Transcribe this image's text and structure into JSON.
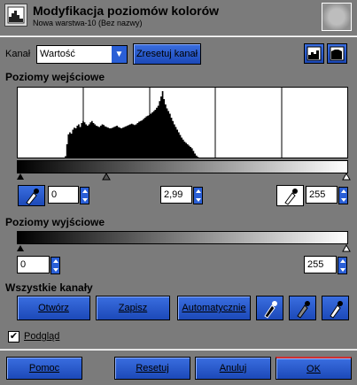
{
  "title": {
    "main": "Modyfikacja poziomów kolorów",
    "subtitle": "Nowa warstwa-10 (Bez nazwy)"
  },
  "channel": {
    "label": "Kanał",
    "selected": "Wartość",
    "reset_label": "Zresetuj kanał"
  },
  "input_levels": {
    "label": "Poziomy wejściowe",
    "low": "0",
    "gamma": "2,99",
    "high": "255"
  },
  "output_levels": {
    "label": "Poziomy wyjściowe",
    "low": "0",
    "high": "255"
  },
  "all_channels": {
    "label": "Wszystkie kanały",
    "open": "Otwórz",
    "save": "Zapisz",
    "auto": "Automatycznie"
  },
  "preview": {
    "label": "Podgląd",
    "checked": true
  },
  "footer": {
    "help": "Pomoc",
    "reset": "Resetuj",
    "cancel": "Anuluj",
    "ok": "OK"
  },
  "icons": {
    "dialog": "levels-dialog-icon",
    "picker": "eyedropper-icon",
    "linear": "linear-histogram-icon",
    "log": "logarithmic-histogram-icon"
  },
  "colors": {
    "background": "#7b7b7b",
    "button": "#2a5fd6",
    "ok_border": "#d03030"
  },
  "histogram": [
    0,
    0,
    0,
    0,
    0,
    0,
    0,
    0,
    0,
    0,
    0,
    0,
    0,
    0,
    0,
    0,
    0,
    0,
    0,
    0,
    0,
    0,
    0,
    0,
    0,
    0,
    0,
    0,
    0,
    0,
    0,
    0,
    0.02,
    0.2,
    0.35,
    0.38,
    0.36,
    0.42,
    0.45,
    0.44,
    0.48,
    0.5,
    0.46,
    0.52,
    0.55,
    0.53,
    0.5,
    0.48,
    0.5,
    0.53,
    0.55,
    0.52,
    0.5,
    0.48,
    0.47,
    0.46,
    0.48,
    0.5,
    0.49,
    0.47,
    0.46,
    0.45,
    0.44,
    0.44,
    0.45,
    0.46,
    0.47,
    0.48,
    0.46,
    0.45,
    0.44,
    0.45,
    0.46,
    0.47,
    0.48,
    0.49,
    0.5,
    0.51,
    0.5,
    0.49,
    0.5,
    0.52,
    0.54,
    0.55,
    0.56,
    0.58,
    0.6,
    0.62,
    0.63,
    0.64,
    0.66,
    0.68,
    0.7,
    0.72,
    0.75,
    0.78,
    0.85,
    0.92,
    1.0,
    0.88,
    0.8,
    0.74,
    0.7,
    0.66,
    0.6,
    0.55,
    0.5,
    0.46,
    0.42,
    0.38,
    0.34,
    0.3,
    0.27,
    0.24,
    0.22,
    0.2,
    0.18,
    0.16,
    0.14,
    0.1,
    0.06,
    0.03,
    0.01,
    0,
    0,
    0,
    0,
    0,
    0,
    0,
    0,
    0,
    0,
    0,
    0,
    0,
    0,
    0,
    0,
    0,
    0,
    0,
    0,
    0,
    0,
    0,
    0,
    0,
    0,
    0,
    0,
    0,
    0,
    0,
    0,
    0,
    0,
    0,
    0,
    0,
    0,
    0,
    0,
    0,
    0,
    0,
    0,
    0,
    0,
    0,
    0,
    0,
    0,
    0,
    0,
    0,
    0,
    0,
    0,
    0,
    0,
    0,
    0,
    0,
    0,
    0,
    0,
    0,
    0,
    0,
    0,
    0,
    0,
    0,
    0,
    0,
    0,
    0,
    0,
    0,
    0,
    0,
    0,
    0,
    0,
    0,
    0,
    0,
    0,
    0,
    0,
    0,
    0,
    0,
    0,
    0,
    0,
    0,
    0,
    0,
    0,
    0,
    0,
    0
  ]
}
